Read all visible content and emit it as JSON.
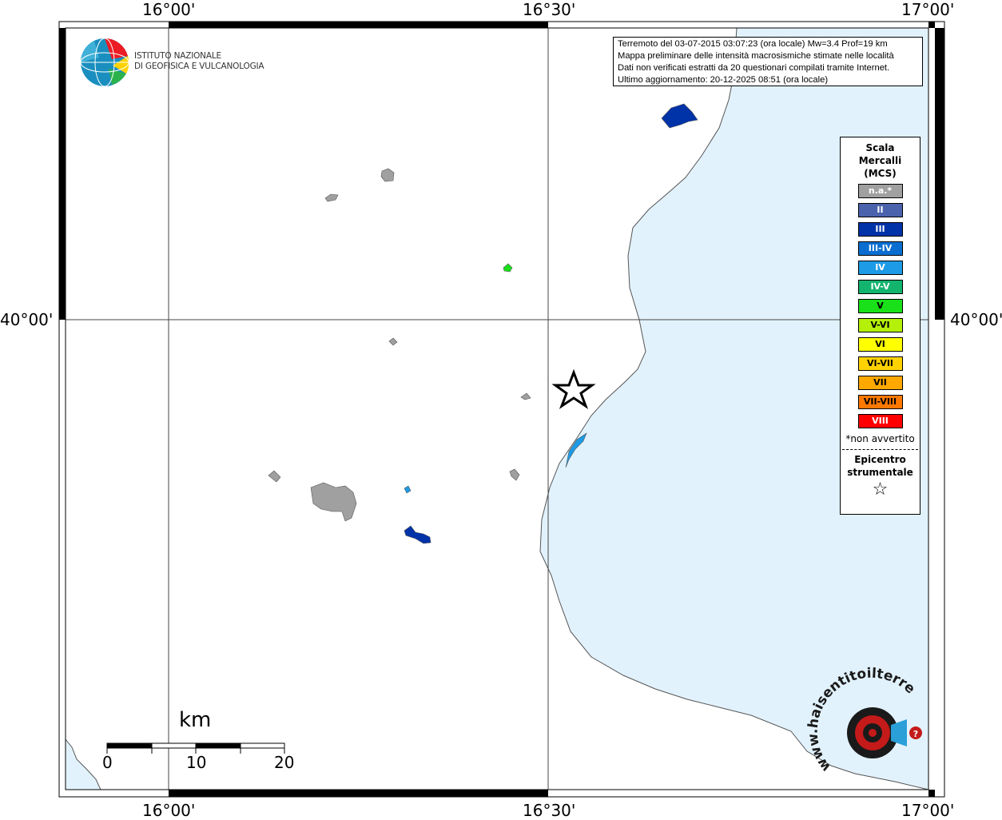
{
  "map": {
    "lon_ticks": [
      "16°00'",
      "16°30'",
      "17°00'"
    ],
    "lat_ticks": [
      "40°00'"
    ],
    "sea_color": "#e2f2fd",
    "epicenter_symbol": "star-outline"
  },
  "info": {
    "line1": "Terremoto del 03-07-2015 03:07:23 (ora locale) Mw=3.4 Prof=19 km",
    "line2": "Mappa preliminare delle intensità macrosismiche stimate nelle località",
    "line3": "Dati non verificati estratti da 20 questionari compilati tramite Internet.",
    "line4": "Ultimo aggiornamento: 20-12-2025 08:51 (ora locale)"
  },
  "logo": {
    "line1": "ISTITUTO NAZIONALE",
    "line2": "DI GEOFISICA E VULCANOLOGIA"
  },
  "legend": {
    "title": [
      "Scala",
      "Mercalli",
      "(MCS)"
    ],
    "items": [
      {
        "label": "n.a.*",
        "color": "#a0a0a0"
      },
      {
        "label": "II",
        "color": "#4b63ad"
      },
      {
        "label": "III",
        "color": "#0032a8"
      },
      {
        "label": "III-IV",
        "color": "#0a6ed0"
      },
      {
        "label": "IV",
        "color": "#1e9be6"
      },
      {
        "label": "IV-V",
        "color": "#12b46e"
      },
      {
        "label": "V",
        "color": "#19e019"
      },
      {
        "label": "V-VI",
        "color": "#b4f00a"
      },
      {
        "label": "VI",
        "color": "#ffff00"
      },
      {
        "label": "VI-VII",
        "color": "#ffd200"
      },
      {
        "label": "VII",
        "color": "#ffa800"
      },
      {
        "label": "VII-VIII",
        "color": "#ff7800"
      },
      {
        "label": "VIII",
        "color": "#ff0000"
      }
    ],
    "note": "*non avvertito",
    "epicenter": [
      "Epicentro",
      "strumentale"
    ],
    "epicenter_glyph": "☆"
  },
  "scale_bar": {
    "unit": "km",
    "labels": [
      "0",
      "10",
      "20"
    ]
  },
  "watermark": "www.haisentitoilterremoto.it"
}
